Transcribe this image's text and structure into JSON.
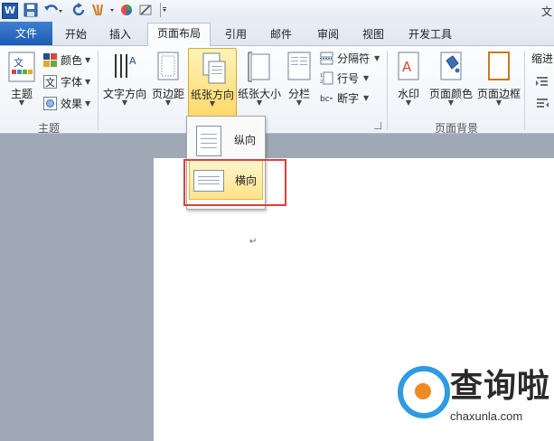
{
  "titlebar": {
    "app_logo": "W",
    "title_fragment": "文"
  },
  "tabs": [
    "文件",
    "开始",
    "插入",
    "页面布局",
    "引用",
    "邮件",
    "审阅",
    "视图",
    "开发工具"
  ],
  "active_tab": "页面布局",
  "ribbon": {
    "theme_group": {
      "label": "主题",
      "themes_button": "主题",
      "colors": "颜色",
      "fonts": "字体",
      "effects": "效果"
    },
    "page_setup": {
      "text_direction": "文字方向",
      "margins": "页边距",
      "orientation": "纸张方向",
      "size": "纸张大小",
      "columns": "分栏",
      "breaks": "分隔符",
      "line_numbers": "行号",
      "hyphenation": "断字"
    },
    "page_background": {
      "label": "页面背景",
      "watermark": "水印",
      "page_color": "页面颜色",
      "page_borders": "页面边框"
    },
    "indent_label_fragment": "缩进"
  },
  "orientation_menu": {
    "portrait": "纵向",
    "landscape": "横向"
  },
  "document": {
    "paragraph_mark": "↵"
  },
  "watermark_logo": {
    "text": "查询啦",
    "site": "chaxunla.com"
  },
  "colors": {
    "accent_blue": "#1d5bb3",
    "highlight_yellow": "#ffd96b",
    "callout_red": "#d9413d"
  }
}
